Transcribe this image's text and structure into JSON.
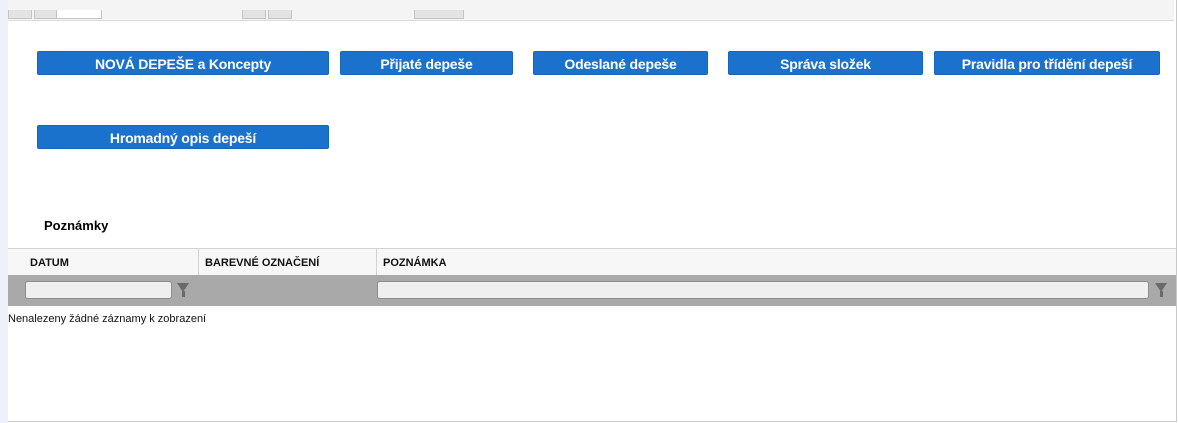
{
  "actions": {
    "row1": [
      {
        "label": "NOVÁ DEPEŠE a Koncepty"
      },
      {
        "label": "Přijaté depeše"
      },
      {
        "label": "Odeslané depeše"
      },
      {
        "label": "Správa složek"
      },
      {
        "label": "Pravidla pro třídění depeší"
      }
    ],
    "row2": [
      {
        "label": "Hromadný opis depeší"
      }
    ]
  },
  "notes": {
    "title": "Poznámky",
    "columns": [
      "DATUM",
      "BAREVNÉ OZNAČENÍ",
      "POZNÁMKA"
    ],
    "empty_message": "Nenalezeny žádné záznamy k zobrazení"
  },
  "colors": {
    "button_bg": "#1a72cc",
    "button_text": "#ffffff",
    "filter_row_bg": "#a9a9a9",
    "left_strip": "#eef0fa"
  },
  "icons": [
    "filter-funnel-icon"
  ]
}
